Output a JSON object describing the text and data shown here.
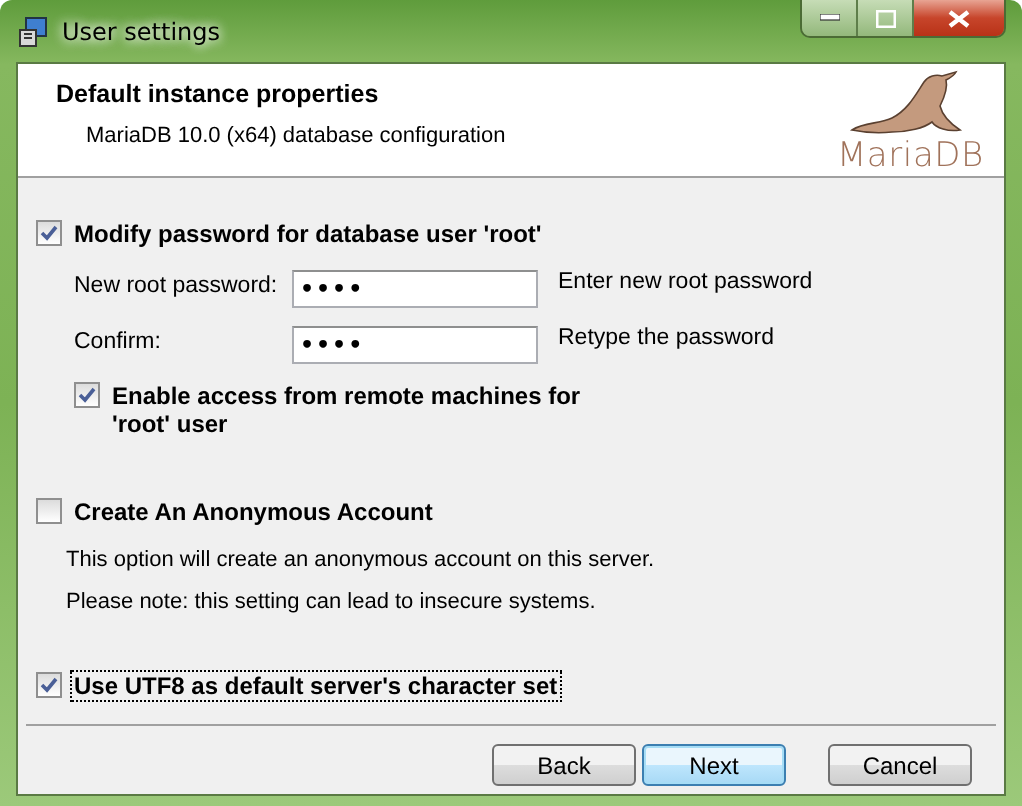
{
  "window": {
    "title": "User settings"
  },
  "header": {
    "title": "Default instance properties",
    "subtitle": "MariaDB 10.0 (x64) database configuration",
    "logo_text": "MariaDB"
  },
  "password_section": {
    "checkbox": {
      "label": "Modify password for database user 'root'",
      "checked": true
    },
    "fields": [
      {
        "label": "New root password:",
        "value": "••••",
        "hint": "Enter new root password"
      },
      {
        "label": "Confirm:",
        "value": "••••",
        "hint": "Retype the password"
      }
    ],
    "remote_access": {
      "label": "Enable access from remote machines for 'root' user",
      "checked": true
    }
  },
  "anonymous_section": {
    "checkbox": {
      "label": "Create An Anonymous Account",
      "checked": false
    },
    "notes": [
      "This option will create an anonymous account on this server.",
      "Please note: this setting can lead to insecure systems."
    ]
  },
  "utf8": {
    "label": "Use UTF8 as default server's character set",
    "checked": true,
    "focused": true
  },
  "buttons": [
    {
      "label": "Back",
      "default": false
    },
    {
      "label": "Next",
      "default": true
    },
    {
      "label": "Cancel",
      "default": false
    }
  ]
}
